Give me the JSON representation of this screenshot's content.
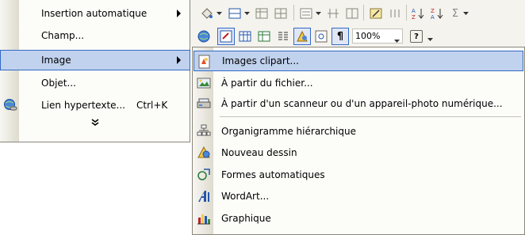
{
  "left_menu": {
    "items": [
      {
        "label": "Insertion automatique",
        "has_submenu": true
      },
      {
        "label": "Champ..."
      },
      {
        "label": "Image",
        "has_submenu": true,
        "active": true
      },
      {
        "label": "Objet..."
      },
      {
        "label": "Lien hypertexte...",
        "shortcut": "Ctrl+K",
        "icon": "globe-link-icon"
      }
    ],
    "expand_glyph": "⌄"
  },
  "submenu": {
    "items": [
      {
        "label": "Images clipart...",
        "icon": "clipart-icon",
        "active": true
      },
      {
        "label": "À partir du fichier...",
        "icon": "picture-file-icon"
      },
      {
        "label": "À partir d'un scanneur ou d'un appareil-photo numérique...",
        "icon": "scanner-icon"
      },
      {
        "label": "Organigramme hiérarchique",
        "icon": "org-chart-icon"
      },
      {
        "label": "Nouveau dessin",
        "icon": "drawing-icon"
      },
      {
        "label": "Formes automatiques",
        "icon": "autoshapes-icon"
      },
      {
        "label": "WordArt...",
        "icon": "wordart-icon"
      },
      {
        "label": "Graphique",
        "icon": "chart-icon"
      }
    ]
  },
  "toolbar": {
    "zoom_value": "100%",
    "paragraph_mark": "¶",
    "sigma": "Σ",
    "help_glyph": "?"
  },
  "colors": {
    "highlight_bg": "#c1d2ee",
    "highlight_border": "#316ac5",
    "menu_bg": "#fcfcf9"
  }
}
